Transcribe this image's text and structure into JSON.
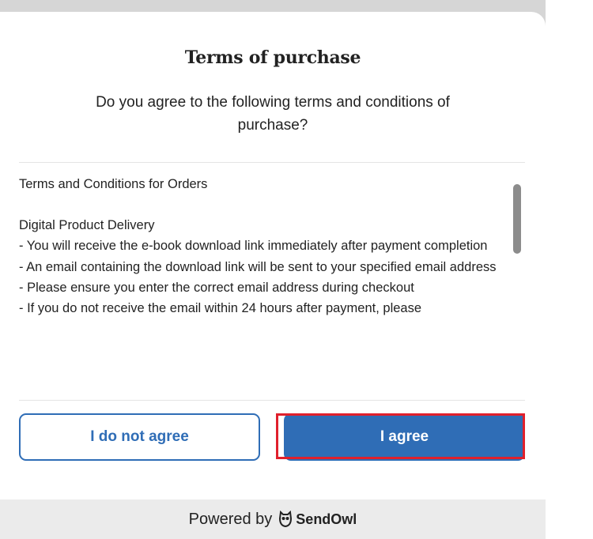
{
  "modal": {
    "title": "Terms of purchase",
    "question": "Do you agree to the following terms and conditions of purchase?",
    "terms_lines": [
      "Terms and Conditions for Orders",
      "",
      "Digital Product Delivery",
      "- You will receive the e-book download link immediately after payment completion",
      "- An email containing the download link will be sent to your specified email address",
      "- Please ensure you enter the correct email address during checkout",
      "- If you do not receive the email within 24 hours after payment, please"
    ],
    "disagree_label": "I do not agree",
    "agree_label": "I agree"
  },
  "footer": {
    "powered_by": "Powered by",
    "brand_name": "SendOwl",
    "brand_icon": "owl-icon"
  },
  "colors": {
    "accent": "#2f6db6",
    "highlight": "#e0202c",
    "footer_bg": "#ebebeb",
    "backdrop": "#d6d6d6"
  }
}
